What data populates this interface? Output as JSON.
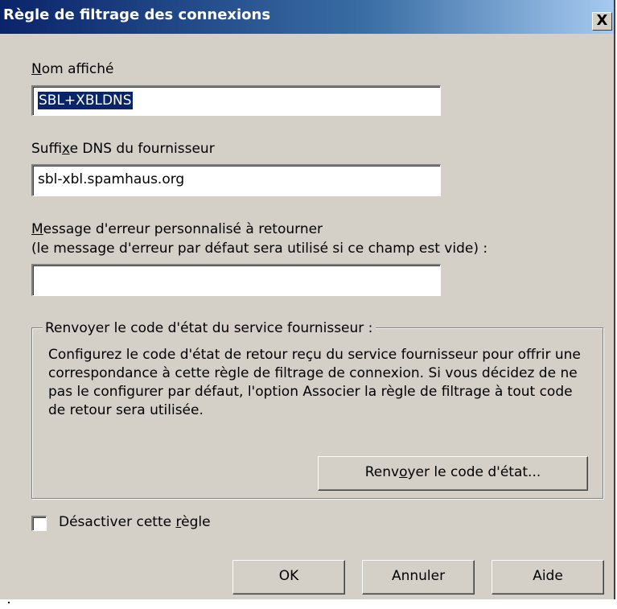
{
  "window": {
    "title": "Règle de filtrage des connexions",
    "close_glyph": "X"
  },
  "fields": {
    "display_name": {
      "label_mnemonic": "N",
      "label_rest": "om affiché",
      "value": "SBL+XBLDNS"
    },
    "dns_suffix": {
      "label_before": "Suffi",
      "label_mnemonic": "x",
      "label_after": "e DNS du fournisseur",
      "value": "sbl-xbl.spamhaus.org"
    },
    "error_message": {
      "label_mnemonic": "M",
      "label_rest": "essage d'erreur personnalisé à retourner",
      "label_line2": "(le message d'erreur par défaut sera utilisé si ce champ est vide) :",
      "value": ""
    }
  },
  "group": {
    "legend": "Renvoyer le code d'état du service fournisseur :",
    "description": "Configurez le code d'état de retour reçu du service fournisseur pour offrir une correspondance à cette règle de filtrage de connexion. Si vous décidez de ne pas le configurer par défaut, l'option Associer la règle de filtrage à tout code de retour sera utilisée.",
    "button_before": "Renv",
    "button_mnemonic": "o",
    "button_after": "yer le code d'état..."
  },
  "disable_rule": {
    "label_before": "Désactiver cette ",
    "label_mnemonic": "r",
    "label_after": "ègle",
    "checked": false
  },
  "buttons": {
    "ok": "OK",
    "cancel": "Annuler",
    "help": "Aide"
  },
  "colors": {
    "dialog_bg": "#d4d0c8",
    "titlebar_start": "#0a246a",
    "titlebar_end": "#a6caf0",
    "selection": "#0a246a"
  }
}
